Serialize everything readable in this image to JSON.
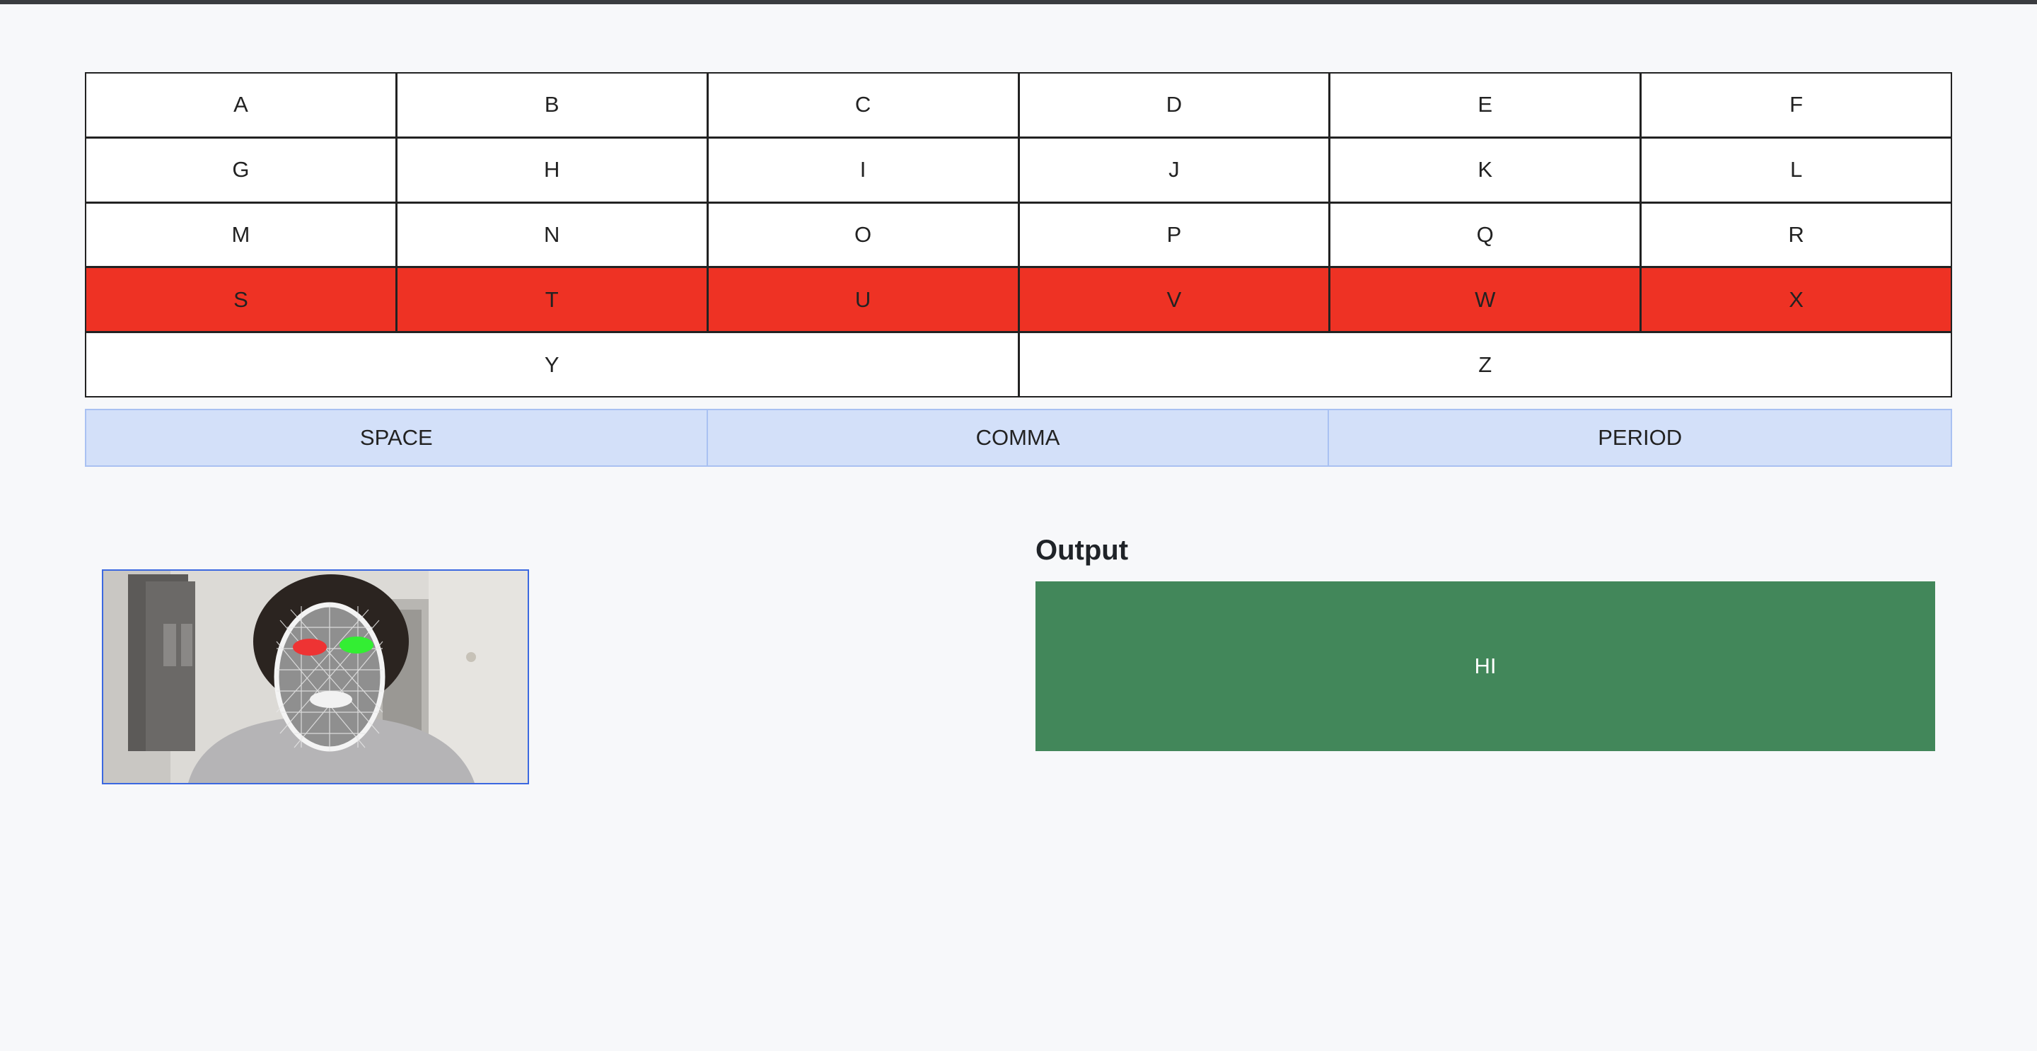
{
  "keyboard": {
    "rows": [
      [
        "A",
        "B",
        "C",
        "D",
        "E",
        "F"
      ],
      [
        "G",
        "H",
        "I",
        "J",
        "K",
        "L"
      ],
      [
        "M",
        "N",
        "O",
        "P",
        "Q",
        "R"
      ],
      [
        "S",
        "T",
        "U",
        "V",
        "W",
        "X"
      ]
    ],
    "last_row": [
      "Y",
      "Z"
    ],
    "highlighted_row": 3,
    "highlight_color": "#ee3224"
  },
  "punctuation": {
    "space": "SPACE",
    "comma": "COMMA",
    "period": "PERIOD"
  },
  "output": {
    "title": "Output",
    "text": "HI",
    "box_color": "#42875a"
  },
  "camera": {
    "left_eye_color": "#ee3333",
    "right_eye_color": "#33ee33"
  }
}
